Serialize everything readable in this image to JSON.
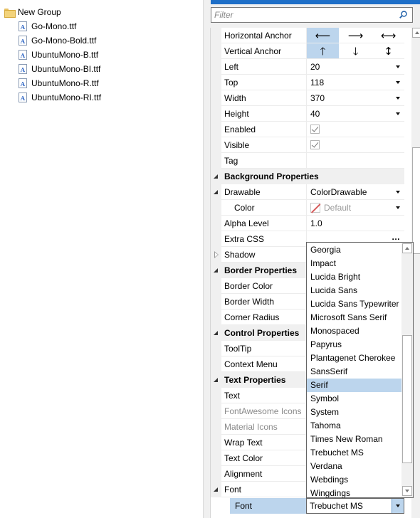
{
  "tree": {
    "group_label": "New Group",
    "files": [
      "Go-Mono.ttf",
      "Go-Mono-Bold.ttf",
      "UbuntuMono-B.ttf",
      "UbuntuMono-BI.ttf",
      "UbuntuMono-R.ttf",
      "UbuntuMono-RI.ttf"
    ],
    "file_icon_glyph": "A"
  },
  "filter": {
    "placeholder": "Filter"
  },
  "props": {
    "horizontal_anchor": {
      "label": "Horizontal Anchor",
      "options": [
        "⟵",
        "⟶",
        "⟷"
      ],
      "selected": 0
    },
    "vertical_anchor": {
      "label": "Vertical Anchor",
      "options": [
        "🡑",
        "🡓",
        "↕"
      ],
      "selected": 0
    },
    "left": {
      "label": "Left",
      "value": "20"
    },
    "top": {
      "label": "Top",
      "value": "118"
    },
    "width": {
      "label": "Width",
      "value": "370"
    },
    "height": {
      "label": "Height",
      "value": "40"
    },
    "enabled": {
      "label": "Enabled",
      "checked": true
    },
    "visible": {
      "label": "Visible",
      "checked": true
    },
    "tag": {
      "label": "Tag",
      "value": ""
    },
    "background_category": "Background Properties",
    "drawable": {
      "label": "Drawable",
      "value": "ColorDrawable"
    },
    "color": {
      "label": "Color",
      "value": "Default"
    },
    "alpha_level": {
      "label": "Alpha Level",
      "value": "1.0"
    },
    "extra_css": {
      "label": "Extra CSS",
      "value": "..."
    },
    "shadow": {
      "label": "Shadow"
    },
    "border_category": "Border Properties",
    "border_color": {
      "label": "Border Color"
    },
    "border_width": {
      "label": "Border Width"
    },
    "corner_radius": {
      "label": "Corner Radius"
    },
    "control_category": "Control Properties",
    "tooltip": {
      "label": "ToolTip"
    },
    "context_menu": {
      "label": "Context Menu"
    },
    "text_category": "Text Properties",
    "text": {
      "label": "Text"
    },
    "fontawesome_icons": {
      "label": "FontAwesome Icons"
    },
    "material_icons": {
      "label": "Material Icons"
    },
    "wrap_text": {
      "label": "Wrap Text"
    },
    "text_color": {
      "label": "Text Color"
    },
    "alignment": {
      "label": "Alignment"
    },
    "font_group": {
      "label": "Font"
    },
    "font": {
      "label": "Font",
      "value": "Trebuchet MS"
    }
  },
  "font_list": {
    "items": [
      "Georgia",
      "Impact",
      "Lucida Bright",
      "Lucida Sans",
      "Lucida Sans Typewriter",
      "Microsoft Sans Serif",
      "Monospaced",
      "Papyrus",
      "Plantagenet Cherokee",
      "SansSerif",
      "Serif",
      "Symbol",
      "System",
      "Tahoma",
      "Times New Roman",
      "Trebuchet MS",
      "Verdana",
      "Webdings",
      "Wingdings"
    ],
    "selected": "Serif"
  },
  "colors": {
    "accent": "#1e6fc8",
    "selection": "#bcd5ed",
    "category_bg": "#f0f0f0"
  }
}
